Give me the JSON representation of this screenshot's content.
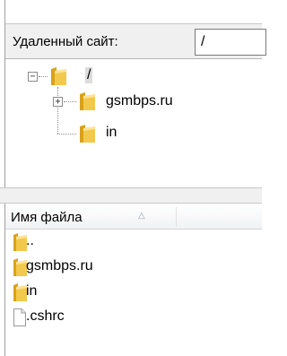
{
  "remote": {
    "label": "Удаленный сайт:",
    "path_value": "/"
  },
  "tree": {
    "root": {
      "label": "/",
      "expanded": true,
      "icon": "folder-icon"
    },
    "children": [
      {
        "label": "gsmbps.ru",
        "expander": "+",
        "icon": "folder-icon"
      },
      {
        "label": "in",
        "icon": "folder-icon"
      }
    ]
  },
  "file_list": {
    "header": {
      "name_label": "Имя файла",
      "sort_indicator": "△"
    },
    "rows": [
      {
        "name": "..",
        "icon": "folder-icon"
      },
      {
        "name": "gsmbps.ru",
        "icon": "folder-icon"
      },
      {
        "name": "in",
        "icon": "folder-icon"
      },
      {
        "name": ".cshrc",
        "icon": "file-icon"
      }
    ]
  },
  "colors": {
    "folder": "#f2c94c",
    "folder_dark": "#d9a21b",
    "selection": "#dcdcdc"
  }
}
